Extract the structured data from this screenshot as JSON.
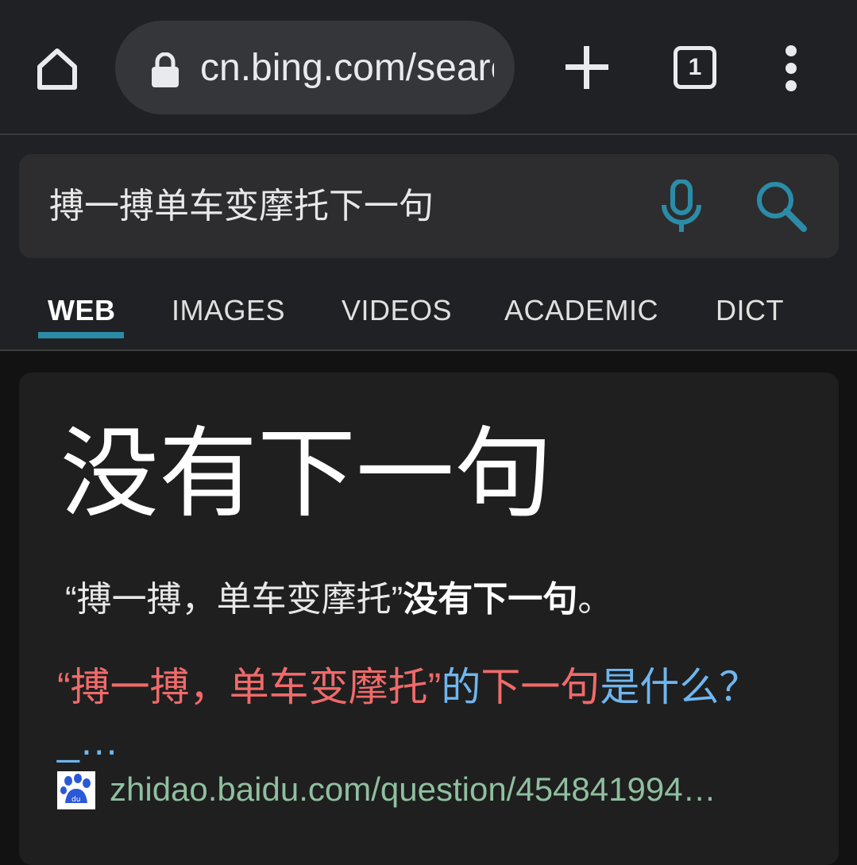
{
  "browser": {
    "url": "cn.bing.com/search",
    "tab_count": "1",
    "icons": {
      "home": "home-icon",
      "lock": "lock-icon",
      "new_tab": "plus-icon",
      "tabs": "tabs-icon",
      "menu": "more-vert-icon"
    }
  },
  "search": {
    "query": "搏一搏单车变摩托下一句",
    "icons": {
      "mic": "microphone-icon",
      "search": "search-icon"
    },
    "accent_color": "#2b8ca8"
  },
  "tabs": [
    {
      "label": "WEB",
      "active": true
    },
    {
      "label": "IMAGES",
      "active": false
    },
    {
      "label": "VIDEOS",
      "active": false
    },
    {
      "label": "ACADEMIC",
      "active": false
    },
    {
      "label": "DICT",
      "active": false
    }
  ],
  "answer": {
    "title": "没有下一句",
    "text_prefix": "“搏一搏，单车变摩托”",
    "text_bold": "没有下一句",
    "text_suffix": "。"
  },
  "result": {
    "link_part1": "“搏一搏，单车变摩托”",
    "link_part2": "的",
    "link_part3": "下一句",
    "link_part4": "是什么？_…",
    "source_url": "zhidao.baidu.com/question/454841994…",
    "favicon": "baidu-paw-icon",
    "link_color": "#6fb6f0",
    "highlight_color": "#f06a6a",
    "url_color": "#8fbf9f"
  }
}
